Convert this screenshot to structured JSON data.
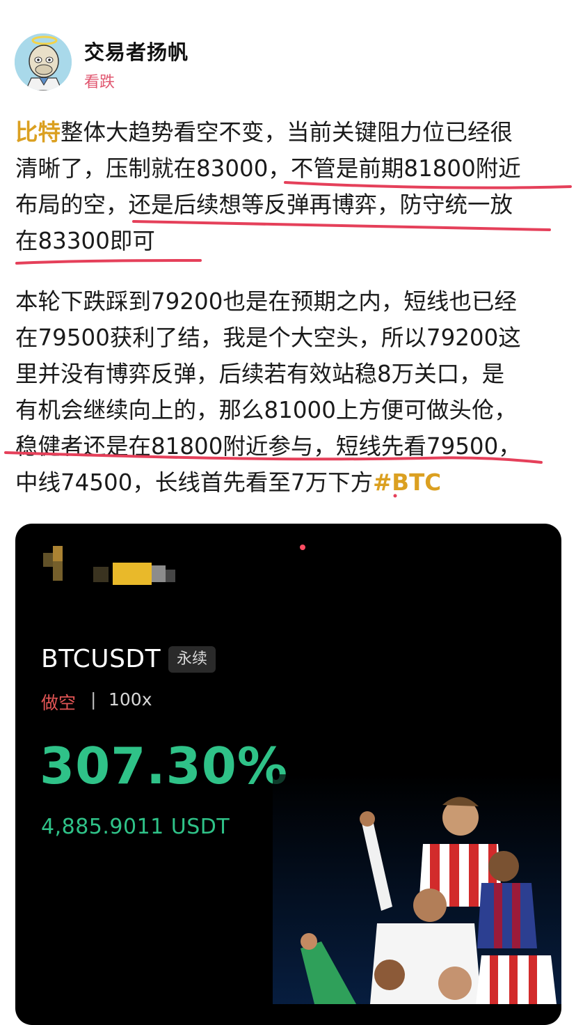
{
  "author": {
    "name": "交易者扬帆",
    "sentiment": "看跌"
  },
  "post": {
    "p1_coin": "比特",
    "p1_line1_rest": "整体大趋势看空不变，当前关键阻力位已经很",
    "p1_line2": "清晰了，压制就在83000，不管是前期81800附近",
    "p1_line3": "布局的空，还是后续想等反弹再博弈，防守统一放",
    "p1_line4": "在83300即可",
    "p2_line1": "本轮下跌踩到79200也是在预期之内，短线也已经",
    "p2_line2": "在79500获利了结，我是个大空头，所以79200这",
    "p2_line3": "里并没有博弈反弹，后续若有效站稳8万关口，是",
    "p2_line4": "有机会继续向上的，那么81000上方便可做头伧，",
    "p2_line5": "稳健者还是在81800附近参与，短线先看79500，",
    "p2_line6": "中线74500，长线首先看至7万下方",
    "hashtag": "#BTC"
  },
  "card": {
    "pair": "BTCUSDT",
    "contract_type": "永续",
    "direction": "做空",
    "separator": "|",
    "leverage": "100x",
    "roi": "307.30%",
    "pnl": "4,885.9011 USDT"
  },
  "colors": {
    "coin_tag": "#dba021",
    "sentiment": "#e0566f",
    "underline": "#e5405a",
    "profit_green": "#2fc288",
    "short_red": "#e25555",
    "card_bg": "#000000"
  },
  "icons": {
    "avatar": "bored-ape-avatar",
    "back": "back-arrow-icon"
  }
}
